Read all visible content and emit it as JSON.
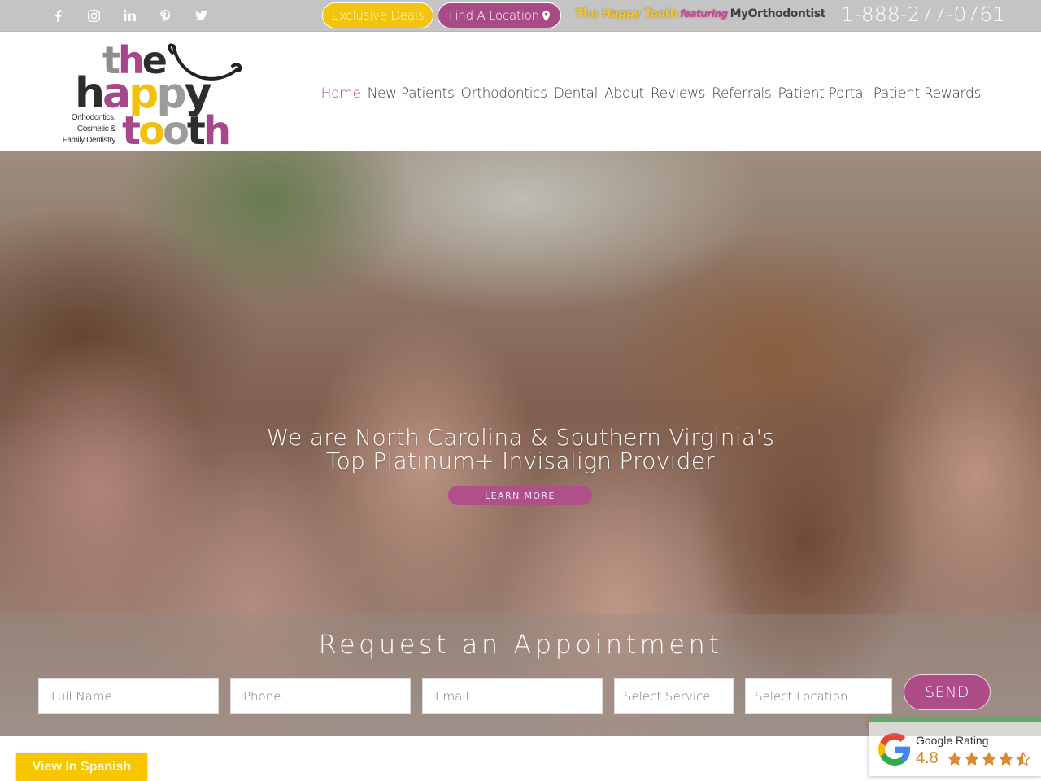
{
  "topbar": {
    "social": [
      {
        "icon": "facebook-icon",
        "glyph": "f"
      },
      {
        "icon": "instagram-icon",
        "glyph": ""
      },
      {
        "icon": "linkedin-icon",
        "glyph": "in"
      },
      {
        "icon": "pinterest-icon",
        "glyph": ""
      },
      {
        "icon": "twitter-icon",
        "glyph": ""
      }
    ],
    "deals_label": "Exclusive Deals",
    "location_label": "Find A Location",
    "brand_part1": "The Happy Tooth",
    "brand_part2": "featuring",
    "brand_part3": "MyOrthodontist",
    "phone": "1-888-277-0761"
  },
  "logo": {
    "word1": "the",
    "word2": "happy",
    "word3": "tooth",
    "tagline_line1": "Orthodontics,",
    "tagline_line2": "Cosmetic &",
    "tagline_line3": "Family Dentistry"
  },
  "nav": {
    "items": [
      {
        "label": "Home",
        "active": true
      },
      {
        "label": "New Patients"
      },
      {
        "label": "Orthodontics"
      },
      {
        "label": "Dental"
      },
      {
        "label": "About"
      },
      {
        "label": "Reviews"
      },
      {
        "label": "Referrals"
      },
      {
        "label": "Patient Portal"
      },
      {
        "label": "Patient Rewards"
      }
    ]
  },
  "hero": {
    "headline_line1": "We are North Carolina & Southern Virginia's",
    "headline_line2": "Top Platinum+ Invisalign Provider",
    "cta_label": "LEARN MORE"
  },
  "appointment": {
    "title": "Request an Appointment",
    "fields": {
      "full_name_placeholder": "Full Name",
      "phone_placeholder": "Phone",
      "email_placeholder": "Email",
      "service_selected": "Select Service",
      "location_selected": "Select Location"
    },
    "send_label": "SEND"
  },
  "spanish_label": "View In Spanish",
  "google_rating": {
    "label": "Google Rating",
    "score": "4.8",
    "stars_out_of_5": 4.5
  },
  "colors": {
    "brand_purple": "#a94a86",
    "brand_yellow": "#f1c40f",
    "google_green": "#4cbb5a",
    "star_orange": "#d98a2a",
    "topbar_gray": "#c4c4c4"
  }
}
